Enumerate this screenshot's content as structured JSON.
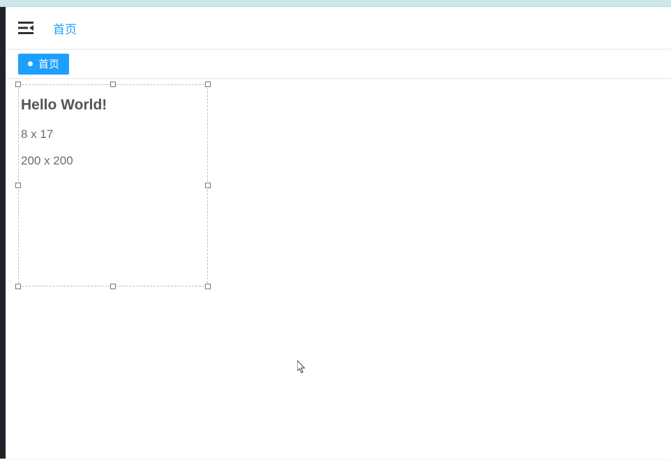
{
  "header": {
    "breadcrumb": "首页"
  },
  "tabs": {
    "active": {
      "label": "首页"
    }
  },
  "widget": {
    "title": "Hello World!",
    "position_text": "8 x 17",
    "size_text": "200 x 200"
  }
}
